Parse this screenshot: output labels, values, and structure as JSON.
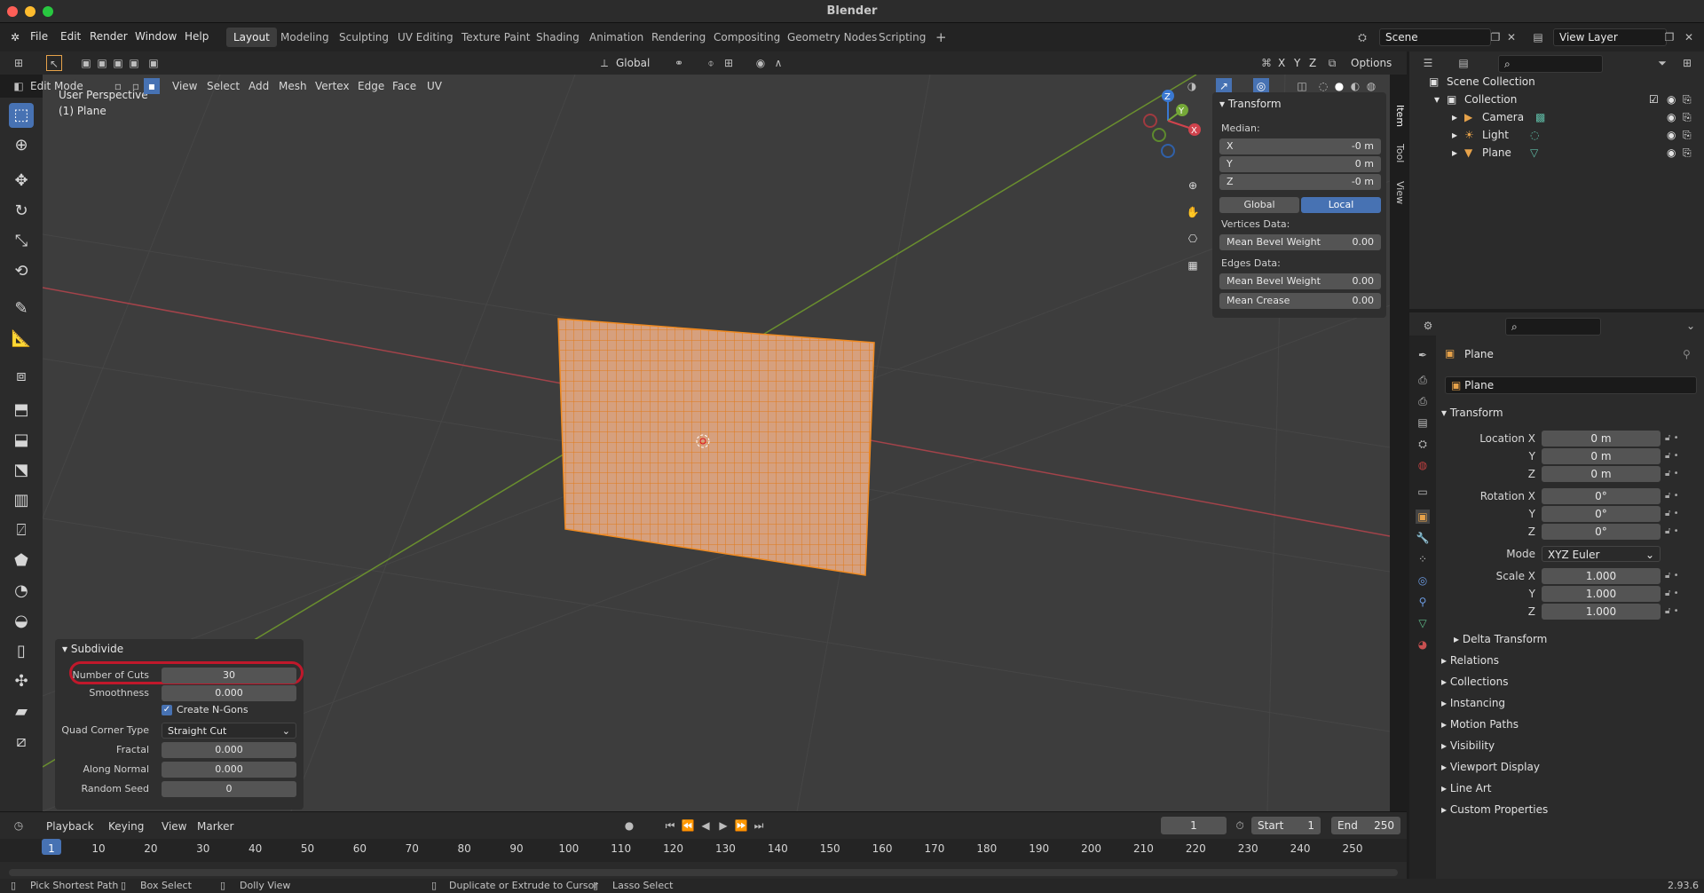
{
  "window": {
    "title": "Blender"
  },
  "menubar": {
    "items": [
      "File",
      "Edit",
      "Render",
      "Window",
      "Help"
    ],
    "workspaces": [
      "Layout",
      "Modeling",
      "Sculpting",
      "UV Editing",
      "Texture Paint",
      "Shading",
      "Animation",
      "Rendering",
      "Compositing",
      "Geometry Nodes",
      "Scripting"
    ],
    "active_workspace": "Layout",
    "add_tab": "+",
    "scene": "Scene",
    "view_layer": "View Layer"
  },
  "header": {
    "orientation": "Global",
    "axes": [
      "X",
      "Y",
      "Z"
    ],
    "options": "Options",
    "mode": "Edit Mode",
    "menus": [
      "View",
      "Select",
      "Add",
      "Mesh",
      "Vertex",
      "Edge",
      "Face",
      "UV"
    ]
  },
  "viewport": {
    "perspective": "User Perspective",
    "object": "(1) Plane",
    "gizmo_axes": [
      "Z",
      "Y",
      "X"
    ],
    "side_tabs": [
      "Item",
      "Tool",
      "View"
    ],
    "colors": {
      "bg": "#3d3d3d",
      "mesh": "#d79a6c",
      "mesh_edge": "#e07a1a",
      "x_axis": "#c0474c",
      "y_axis": "#6f9a2f"
    }
  },
  "npanel": {
    "title": "Transform",
    "median_label": "Median:",
    "median": [
      {
        "axis": "X",
        "value": "-0 m"
      },
      {
        "axis": "Y",
        "value": "0 m"
      },
      {
        "axis": "Z",
        "value": "-0 m"
      }
    ],
    "space": [
      "Global",
      "Local"
    ],
    "active_space": "Local",
    "vertices_label": "Vertices Data:",
    "vertices": [
      {
        "label": "Mean Bevel Weight",
        "value": "0.00"
      }
    ],
    "edges_label": "Edges Data:",
    "edges": [
      {
        "label": "Mean Bevel Weight",
        "value": "0.00"
      },
      {
        "label": "Mean Crease",
        "value": "0.00"
      }
    ]
  },
  "operator": {
    "title": "Subdivide",
    "fields": [
      {
        "label": "Number of Cuts",
        "value": "30",
        "highlighted": true
      },
      {
        "label": "Smoothness",
        "value": "0.000"
      },
      {
        "label": "Create N-Gons",
        "checkbox": true,
        "checked": true
      },
      {
        "label": "Quad Corner Type",
        "value": "Straight Cut",
        "dropdown": true
      },
      {
        "label": "Fractal",
        "value": "0.000"
      },
      {
        "label": "Along Normal",
        "value": "0.000"
      },
      {
        "label": "Random Seed",
        "value": "0"
      }
    ],
    "highlight_color": "#c0182b"
  },
  "timeline": {
    "menus": [
      "Playback",
      "Keying",
      "View",
      "Marker"
    ],
    "current_frame": "1",
    "start_label": "Start",
    "start": "1",
    "end_label": "End",
    "end": "250",
    "ticks": [
      "1",
      "10",
      "20",
      "30",
      "40",
      "50",
      "60",
      "70",
      "80",
      "90",
      "100",
      "110",
      "120",
      "130",
      "140",
      "150",
      "160",
      "170",
      "180",
      "190",
      "200",
      "210",
      "220",
      "230",
      "240",
      "250"
    ]
  },
  "statusbar": {
    "items": [
      "Pick Shortest Path",
      "Box Select",
      "Dolly View",
      "Duplicate or Extrude to Cursor",
      "Lasso Select"
    ],
    "version": "2.93.6"
  },
  "outliner": {
    "root": "Scene Collection",
    "collection": "Collection",
    "objects": [
      "Camera",
      "Light",
      "Plane"
    ]
  },
  "properties": {
    "object_name": "Plane",
    "data_name": "Plane",
    "transform_title": "Transform",
    "location_label": "Location X",
    "location": [
      "0 m",
      "0 m",
      "0 m"
    ],
    "rotation_label": "Rotation X",
    "rotation": [
      "0°",
      "0°",
      "0°"
    ],
    "mode_label": "Mode",
    "mode": "XYZ Euler",
    "scale_label": "Scale X",
    "scale": [
      "1.000",
      "1.000",
      "1.000"
    ],
    "axis_y": "Y",
    "axis_z": "Z",
    "delta": "Delta Transform",
    "sections": [
      "Relations",
      "Collections",
      "Instancing",
      "Motion Paths",
      "Visibility",
      "Viewport Display",
      "Line Art",
      "Custom Properties"
    ]
  }
}
